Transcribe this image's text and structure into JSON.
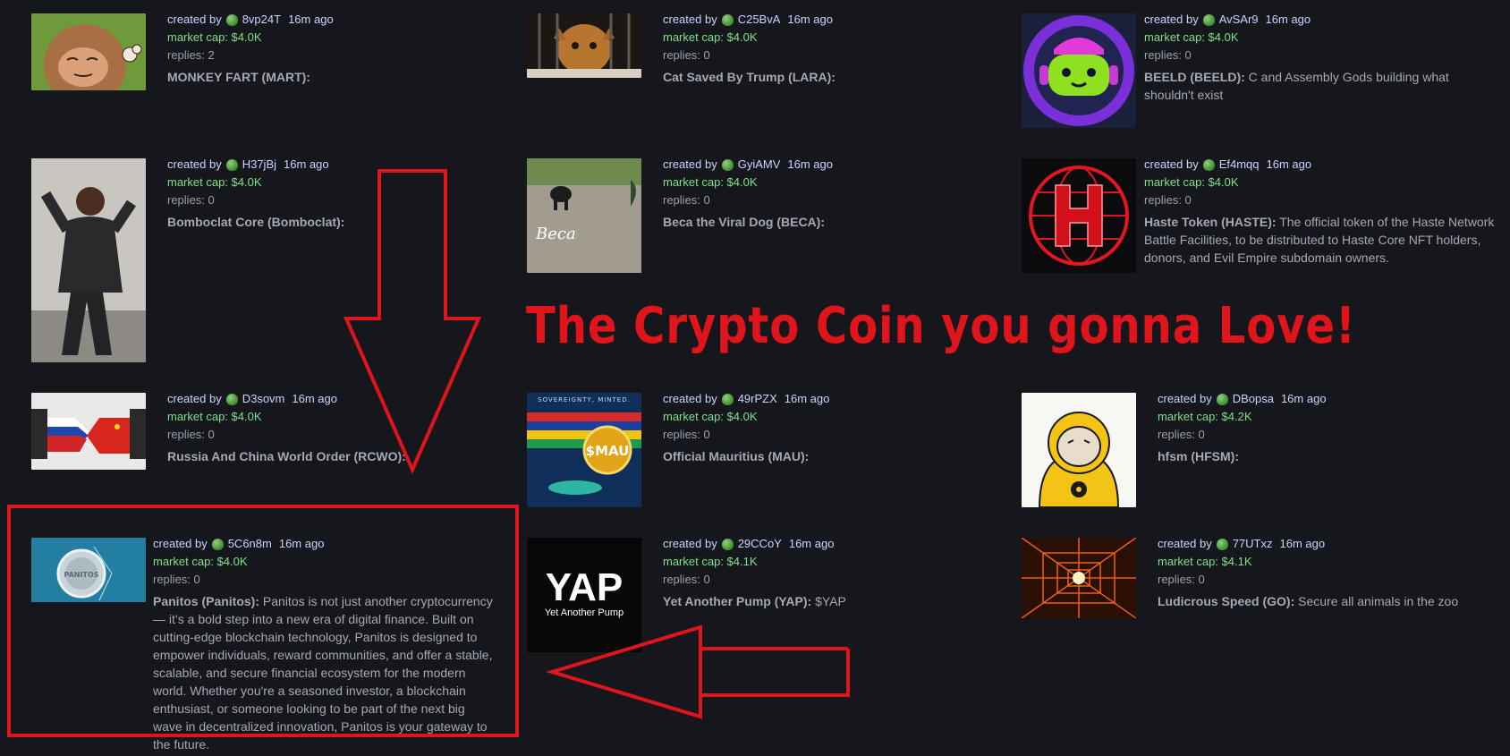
{
  "labels": {
    "created_by": "created by",
    "market_cap_prefix": "market cap: ",
    "replies_prefix": "replies: "
  },
  "headline": "The Crypto Coin you gonna Love!",
  "coins": [
    {
      "creator": "8vp24T",
      "time": "16m ago",
      "market_cap": "$4.0K",
      "replies": "2",
      "name": "MONKEY FART (MART):",
      "description": "",
      "thumb": "cartoon-creature"
    },
    {
      "creator": "C25BvA",
      "time": "16m ago",
      "market_cap": "$4.0K",
      "replies": "0",
      "name": "Cat Saved By Trump (LARA):",
      "description": "",
      "thumb": "cat-photo"
    },
    {
      "creator": "AvSAr9",
      "time": "16m ago",
      "market_cap": "$4.0K",
      "replies": "0",
      "name": "BEELD (BEELD):",
      "description": "C and Assembly Gods building what shouldn't exist",
      "thumb": "robot-logo"
    },
    {
      "creator": "H37jBj",
      "time": "16m ago",
      "market_cap": "$4.0K",
      "replies": "0",
      "name": "Bomboclat Core (Bomboclat):",
      "description": "",
      "thumb": "dancing-man-photo"
    },
    {
      "creator": "GyiAMV",
      "time": "16m ago",
      "market_cap": "$4.0K",
      "replies": "0",
      "name": "Beca the Viral Dog (BECA):",
      "description": "",
      "thumb": "dog-photo",
      "thumb_caption": "Beca"
    },
    {
      "creator": "Ef4mqq",
      "time": "16m ago",
      "market_cap": "$4.0K",
      "replies": "0",
      "name": "Haste Token (HASTE):",
      "description": "The official token of the Haste Network Battle Facilities, to be distributed to Haste Core NFT holders, donors, and Evil Empire subdomain owners.",
      "thumb": "globe-h-logo"
    },
    {
      "creator": "D3sovm",
      "time": "16m ago",
      "market_cap": "$4.0K",
      "replies": "0",
      "name": "Russia And China World Order (RCWO):",
      "description": "",
      "thumb": "handshake-flags"
    },
    {
      "creator": "49rPZX",
      "time": "16m ago",
      "market_cap": "$4.0K",
      "replies": "0",
      "name": "Official Mauritius (MAU):",
      "description": "",
      "thumb": "mauritius-coin",
      "thumb_caption": "SOVEREIGNTY, MINTED.",
      "thumb_coin": "$MAU"
    },
    {
      "creator": "DBopsa",
      "time": "16m ago",
      "market_cap": "$4.2K",
      "replies": "0",
      "name": "hfsm (HFSM):",
      "description": "",
      "thumb": "hazmat-cat"
    },
    {
      "creator": "5C6n8m",
      "time": "16m ago",
      "market_cap": "$4.0K",
      "replies": "0",
      "name": "Panitos (Panitos):",
      "description": "Panitos is not just another cryptocurrency — it’s a bold step into a new era of digital finance. Built on cutting-edge blockchain technology, Panitos is designed to empower individuals, reward communities, and offer a stable, scalable, and secure financial ecosystem for the modern world. Whether you're a seasoned investor, a blockchain enthusiast, or someone looking to be part of the next big wave in decentralized innovation, Panitos is your gateway to the future.",
      "thumb": "panitos-coin",
      "thumb_coin": "PANITOS"
    },
    {
      "creator": "29CCoY",
      "time": "16m ago",
      "market_cap": "$4.1K",
      "replies": "0",
      "name": "Yet Another Pump (YAP):",
      "description": "$YAP",
      "thumb": "yap-logo",
      "thumb_title": "YAP",
      "thumb_subtitle": "Yet Another Pump"
    },
    {
      "creator": "77UTxz",
      "time": "16m ago",
      "market_cap": "$4.1K",
      "replies": "0",
      "name": "Ludicrous Speed (GO):",
      "description": "Secure all animals in the zoo",
      "thumb": "speed-tunnel"
    }
  ],
  "colors": {
    "background": "#16171c",
    "creator_text": "#c9d4ff",
    "market_cap": "#7fe08a",
    "annotation_red": "#e0141b"
  }
}
